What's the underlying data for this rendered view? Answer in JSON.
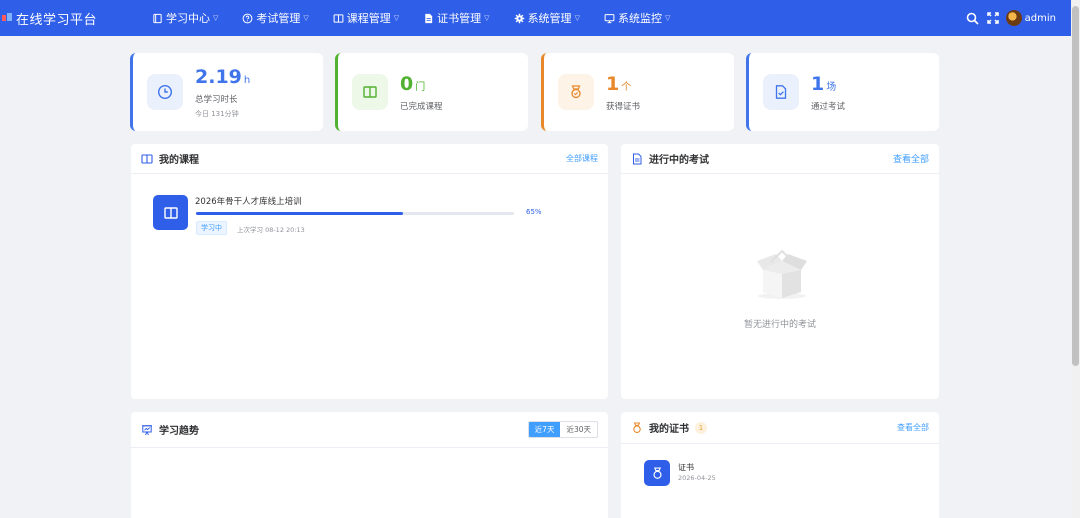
{
  "app": {
    "title": "在线学习平台"
  },
  "nav": [
    {
      "label": "学习中心",
      "icon": "book-icon"
    },
    {
      "label": "考试管理",
      "icon": "help-circle-icon"
    },
    {
      "label": "课程管理",
      "icon": "open-book-icon"
    },
    {
      "label": "证书管理",
      "icon": "document-icon"
    },
    {
      "label": "系统管理",
      "icon": "gear-icon"
    },
    {
      "label": "系统监控",
      "icon": "monitor-icon"
    }
  ],
  "user": {
    "name": "admin"
  },
  "stats": [
    {
      "value": "2.19",
      "unit": "h",
      "label": "总学习时长",
      "sub": "今日 131分钟",
      "color": "#3f74ea",
      "icon": "clock-icon"
    },
    {
      "value": "0",
      "unit": "门",
      "label": "已完成课程",
      "color": "#52b130",
      "icon": "open-book-icon"
    },
    {
      "value": "1",
      "unit": "个",
      "label": "获得证书",
      "color": "#e8882a",
      "icon": "medal-icon"
    },
    {
      "value": "1",
      "unit": "场",
      "label": "通过考试",
      "color": "#3f74ea",
      "icon": "file-check-icon"
    }
  ],
  "my_courses": {
    "title": "我的课程",
    "link": "全部课程",
    "items": [
      {
        "title": "2026年骨干人才库线上培训",
        "progress_percent": 65,
        "progress_label": "65%",
        "status": "学习中",
        "last_study": "上次学习 08-12 20:13"
      }
    ]
  },
  "ongoing_exams": {
    "title": "进行中的考试",
    "link": "查看全部",
    "empty_text": "暂无进行中的考试"
  },
  "trend": {
    "title": "学习趋势",
    "ranges": [
      "近7天",
      "近30天"
    ],
    "active_range": "近7天"
  },
  "certificates": {
    "title": "我的证书",
    "count": "1",
    "link": "查看全部",
    "items": [
      {
        "name": "证书",
        "date": "2026-04-25"
      }
    ]
  },
  "colors": {
    "primary": "#2f5ee8",
    "link": "#409eff",
    "background": "#f0f2f5"
  }
}
